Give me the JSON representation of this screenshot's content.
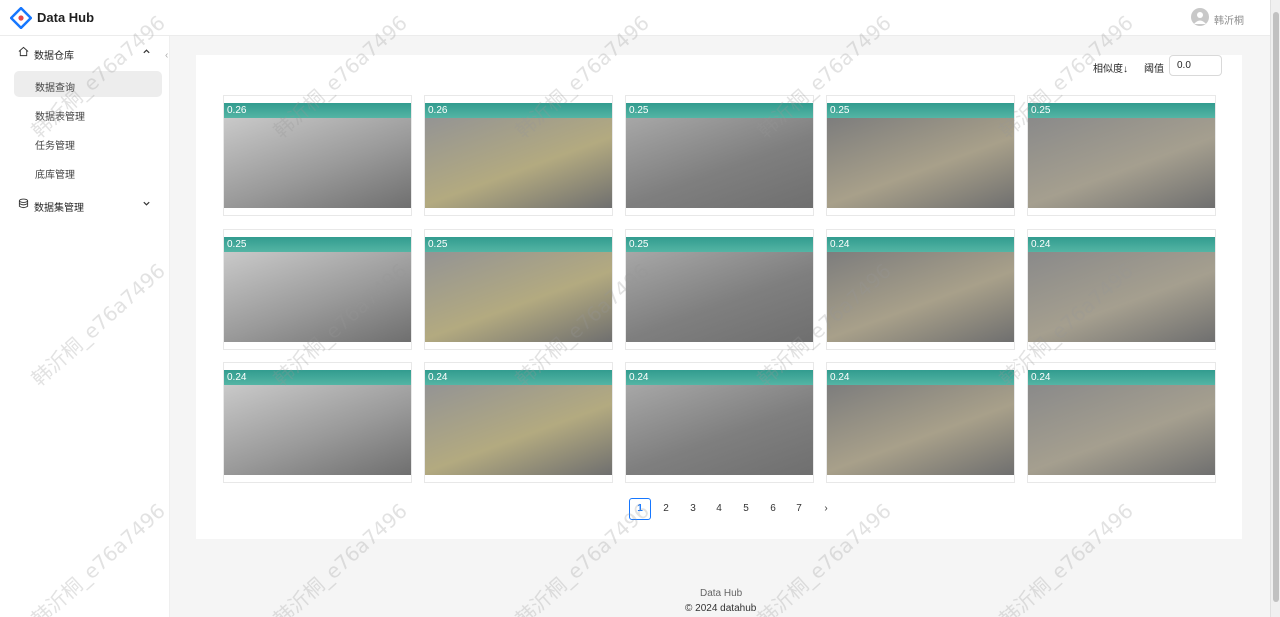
{
  "app": {
    "title": "Data Hub",
    "user": "韩沂桐"
  },
  "sidebar": {
    "groups": [
      {
        "label": "数据仓库",
        "expanded": true
      },
      {
        "label": "数据集管理",
        "expanded": false
      }
    ],
    "items": [
      {
        "label": "数据查询",
        "active": true
      },
      {
        "label": "数据表管理"
      },
      {
        "label": "任务管理"
      },
      {
        "label": "底库管理"
      }
    ]
  },
  "toolbar": {
    "sort_label": "相似度↓",
    "threshold_label": "阈值",
    "threshold_value": "0.0"
  },
  "results": [
    {
      "score": "0.26"
    },
    {
      "score": "0.26"
    },
    {
      "score": "0.25"
    },
    {
      "score": "0.25"
    },
    {
      "score": "0.25"
    },
    {
      "score": "0.25"
    },
    {
      "score": "0.25"
    },
    {
      "score": "0.25"
    },
    {
      "score": "0.24"
    },
    {
      "score": "0.24"
    },
    {
      "score": "0.24"
    },
    {
      "score": "0.24"
    },
    {
      "score": "0.24"
    },
    {
      "score": "0.24"
    },
    {
      "score": "0.24"
    }
  ],
  "pagination": {
    "pages": [
      "1",
      "2",
      "3",
      "4",
      "5",
      "6",
      "7"
    ],
    "current": "1",
    "next": "›"
  },
  "footer": {
    "name": "Data Hub",
    "copyright": "© 2024 datahub"
  },
  "watermark": "韩沂桐_e76a7496",
  "colors": {
    "accent": "#1677ff",
    "score_bar": "#2a9d8f"
  }
}
